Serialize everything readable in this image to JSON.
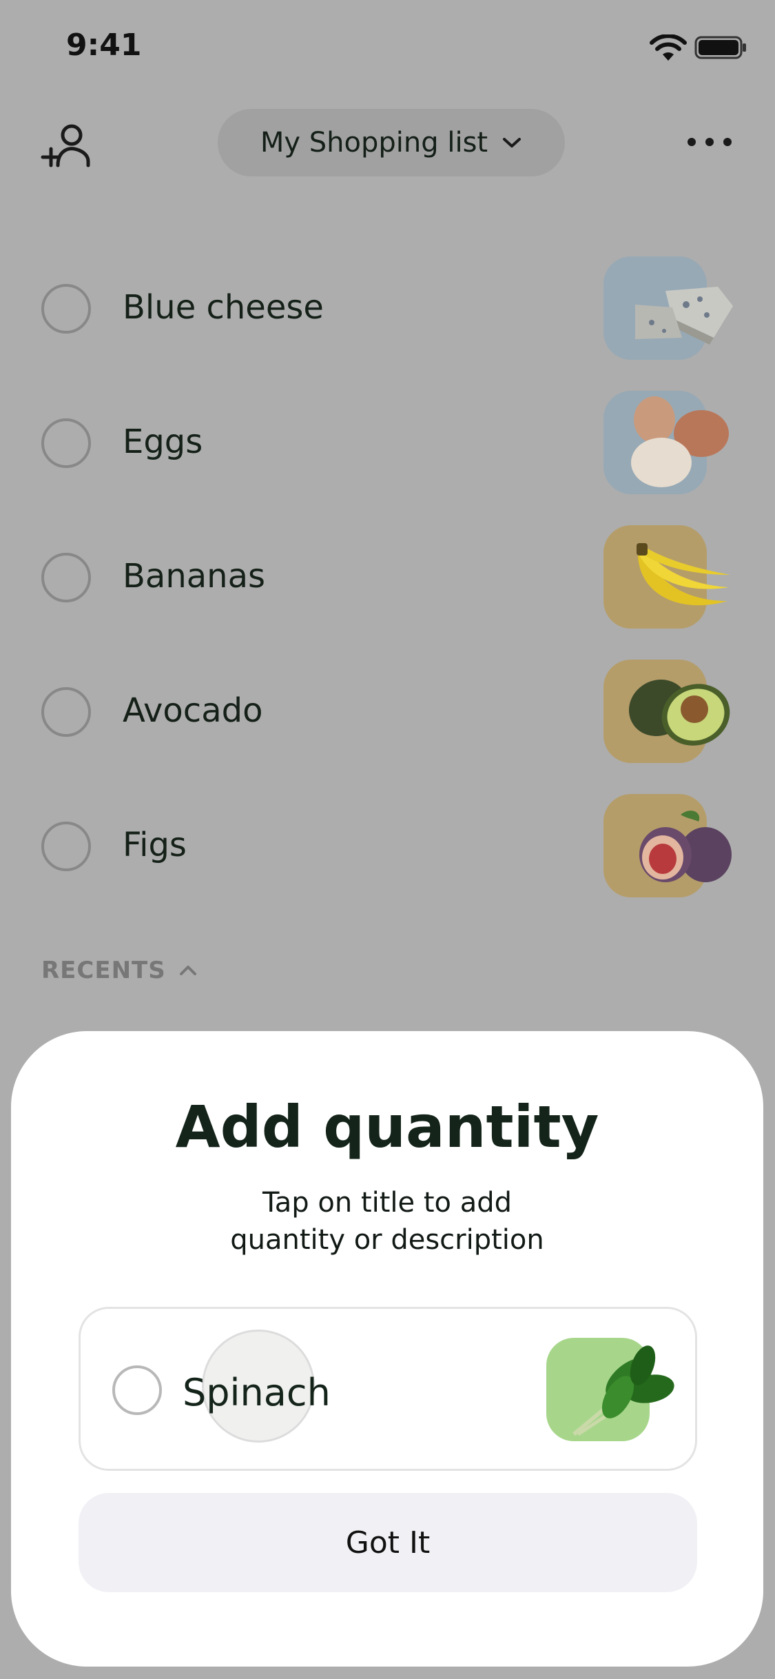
{
  "status_bar": {
    "time": "9:41",
    "wifi_icon": "wifi-icon",
    "battery_icon": "battery-icon"
  },
  "header": {
    "add_member_icon": "add-user-icon",
    "list_title": "My Shopping list",
    "chevron_icon": "chevron-down-icon",
    "more_icon": "more-horizontal-icon"
  },
  "items": [
    {
      "label": "Blue cheese",
      "thumb_color": "#97a9b5"
    },
    {
      "label": "Eggs",
      "thumb_color": "#97a9b5"
    },
    {
      "label": "Bananas",
      "thumb_color": "#b59d6a"
    },
    {
      "label": "Avocado",
      "thumb_color": "#b59d6a"
    },
    {
      "label": "Figs",
      "thumb_color": "#b59d6a"
    }
  ],
  "recents": {
    "label": "RECENTS",
    "chevron_icon": "chevron-up-icon"
  },
  "sheet": {
    "title": "Add quantity",
    "subtitle_line1": "Tap on title to add",
    "subtitle_line2": "quantity or description",
    "demo_item": {
      "label": "Spinach",
      "thumb_color": "#a7d68b"
    },
    "button_label": "Got It"
  }
}
